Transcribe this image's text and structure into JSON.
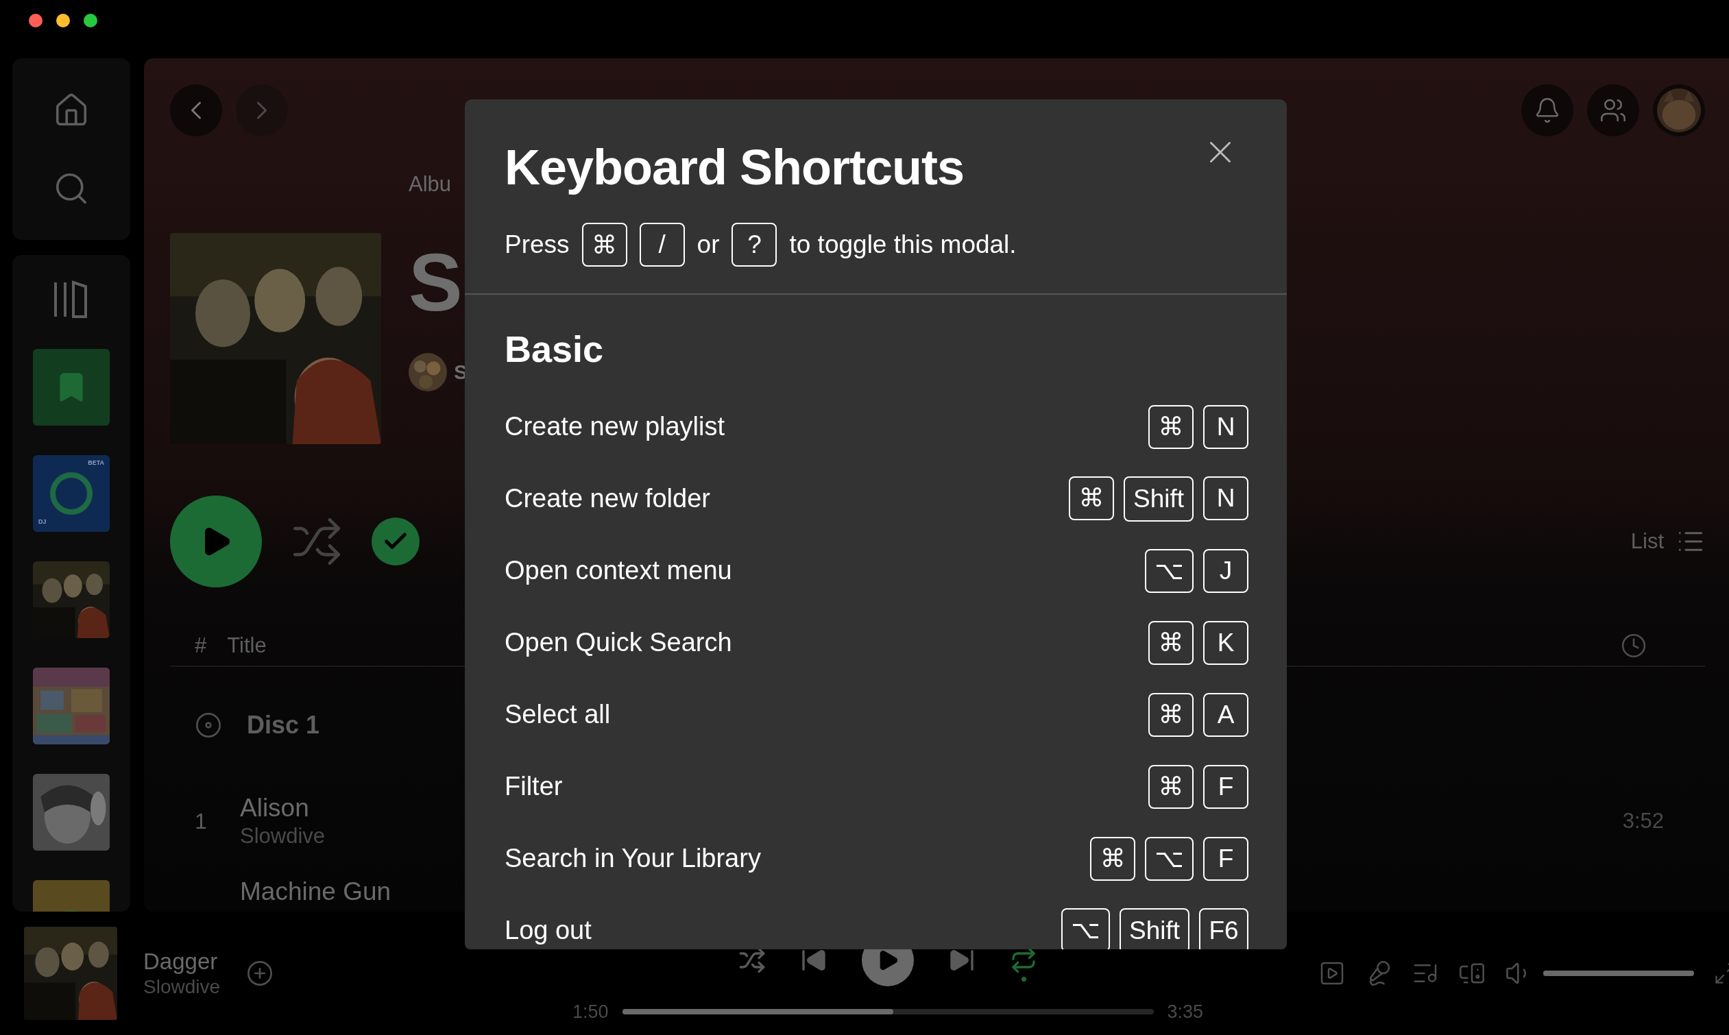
{
  "window": {
    "controls": [
      {
        "color": "#ff5f57"
      },
      {
        "color": "#febc2e"
      },
      {
        "color": "#28c840"
      }
    ]
  },
  "sidebar": {
    "nav": [
      {
        "kind": "home"
      },
      {
        "kind": "search"
      }
    ],
    "library": [
      {
        "kind": "library"
      },
      {
        "kind": "liked"
      },
      {
        "kind": "dj",
        "badge": "BETA",
        "label": "DJ"
      },
      {
        "kind": "cover"
      },
      {
        "kind": "collage"
      },
      {
        "kind": "sketch"
      },
      {
        "kind": "cartoon"
      }
    ]
  },
  "album": {
    "type_label": "Albu",
    "title": "S",
    "artist": "S",
    "saved": true,
    "view": "List",
    "header": {
      "number": "#",
      "title": "Title"
    },
    "disc": "Disc 1",
    "tracks": [
      {
        "number": "1",
        "title": "Alison",
        "artist": "Slowdive",
        "duration": "3:52"
      },
      {
        "title": "Machine Gun"
      }
    ]
  },
  "modal": {
    "title": "Keyboard Shortcuts",
    "hint": [
      {
        "kind": "text",
        "text": "Press"
      },
      {
        "kind": "key",
        "text": "⌘"
      },
      {
        "kind": "key",
        "text": "/"
      },
      {
        "kind": "text",
        "text": "or"
      },
      {
        "kind": "key",
        "text": "?"
      },
      {
        "kind": "text",
        "text": "to toggle this modal."
      }
    ],
    "section": "Basic",
    "shortcuts": [
      {
        "label": "Create new playlist",
        "keys": [
          "⌘",
          "N"
        ]
      },
      {
        "label": "Create new folder",
        "keys": [
          "⌘",
          "Shift",
          "N"
        ]
      },
      {
        "label": "Open context menu",
        "keys": [
          "⌥",
          "J"
        ]
      },
      {
        "label": "Open Quick Search",
        "keys": [
          "⌘",
          "K"
        ]
      },
      {
        "label": "Select all",
        "keys": [
          "⌘",
          "A"
        ]
      },
      {
        "label": "Filter",
        "keys": [
          "⌘",
          "F"
        ]
      },
      {
        "label": "Search in Your Library",
        "keys": [
          "⌘",
          "⌥",
          "F"
        ]
      },
      {
        "label": "Log out",
        "keys": [
          "⌥",
          "Shift",
          "F6"
        ]
      }
    ]
  },
  "player": {
    "track": "Dagger",
    "artist": "Slowdive",
    "shuffle": false,
    "repeat": true,
    "elapsed": "1:50",
    "duration": "3:35",
    "level": 0.51,
    "volume": {
      "level": 1
    }
  }
}
